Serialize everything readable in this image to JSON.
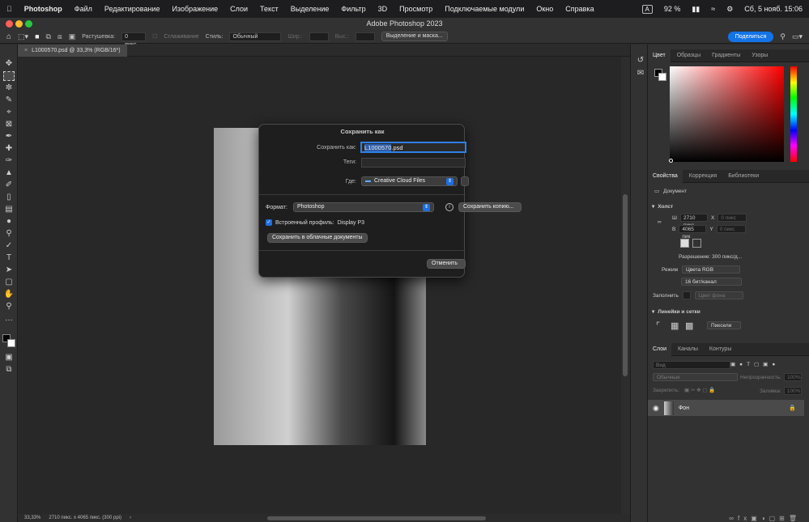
{
  "menubar": {
    "app": "Photoshop",
    "items": [
      "Файл",
      "Редактирование",
      "Изображение",
      "Слои",
      "Текст",
      "Выделение",
      "Фильтр",
      "3D",
      "Просмотр",
      "Подключаемые модули",
      "Окно",
      "Справка"
    ],
    "kbd": "A",
    "battery": "92 %",
    "datetime": "Сб, 5 нояб.  15:06"
  },
  "window": {
    "title": "Adobe Photoshop 2023"
  },
  "options": {
    "feather_label": "Растушевка:",
    "feather_value": "0 пикс.",
    "smooth_label": "Сглаживание",
    "style_label": "Стиль:",
    "style_value": "Обычный",
    "width_label": "Шир.:",
    "height_label": "Выс.:",
    "select_mask": "Выделение и маска...",
    "share": "Поделиться"
  },
  "doc_tab": "L1000570.psd @ 33,3% (RGB/16*)",
  "status": {
    "zoom": "33,33%",
    "info": "2710 пикс. x 4065 пикс. (300 ppi)"
  },
  "dialog": {
    "title": "Сохранить как",
    "save_as_label": "Сохранить как:",
    "filename_sel": "L1000570",
    "filename_ext": ".psd",
    "tags_label": "Теги:",
    "where_label": "Где:",
    "where_value": "Creative Cloud Files",
    "format_label": "Формат:",
    "format_value": "Photoshop",
    "save_copy": "Сохранить копию...",
    "profile_label": "Встроенный профиль:",
    "profile_value": "Display P3",
    "cloud_btn": "Сохранить в облачные документы",
    "cancel": "Отменить"
  },
  "color_panel": {
    "tabs": [
      "Цвет",
      "Образцы",
      "Градиенты",
      "Узоры"
    ]
  },
  "props_panel": {
    "tabs": [
      "Свойства",
      "Коррекция",
      "Библиотеки"
    ],
    "doc_label": "Документ",
    "canvas_section": "Холст",
    "w_label": "Ш",
    "w_value": "2710 пикс",
    "x_label": "X",
    "x_placeholder": "0 пикс",
    "h_label": "В",
    "h_value": "4065 пик",
    "y_label": "Y",
    "y_placeholder": "0 пикс",
    "resolution": "Разрешение: 300 пикс/д...",
    "mode_label": "Режим",
    "mode_value": "Цвета RGB",
    "depth_value": "16 бит/канал",
    "fill_label": "Заполнить",
    "fill_value": "Цвет фона",
    "rulers_section": "Линейки и сетки",
    "units_value": "Пиксели"
  },
  "layers_panel": {
    "tabs": [
      "Слои",
      "Каналы",
      "Контуры"
    ],
    "search_placeholder": "Вид",
    "blend": "Обычные",
    "opacity_label": "Непрозрачность:",
    "opacity_value": "100%",
    "lock_label": "Закрепить:",
    "fill_label": "Заливка:",
    "fill_value": "100%",
    "layer_name": "Фон"
  }
}
